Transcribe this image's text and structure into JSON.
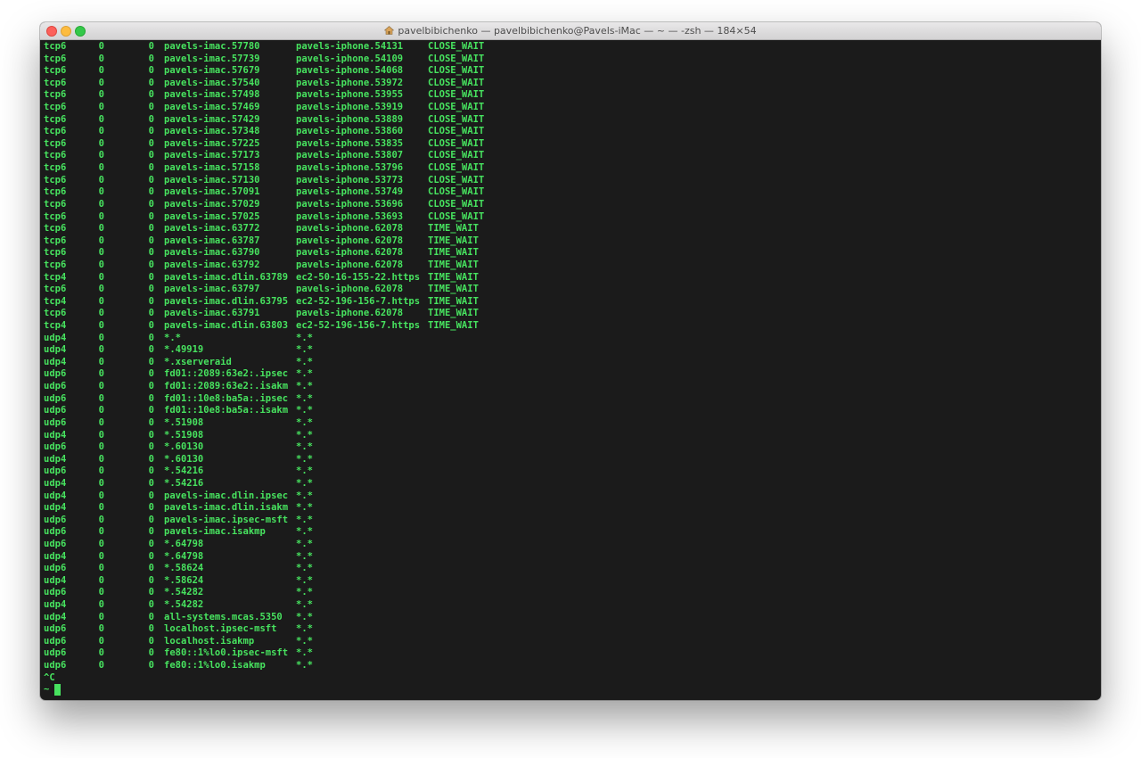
{
  "window": {
    "title": "pavelbibichenko — pavelbibichenko@Pavels-iMac — ~ — -zsh — 184×54",
    "title_icon": "home-icon"
  },
  "terminal": {
    "text_color": "#47e35f",
    "background_color": "#1b1b1b",
    "rows": [
      [
        "tcp6",
        "0",
        "0",
        "pavels-imac.57780",
        "pavels-iphone.54131",
        "CLOSE_WAIT"
      ],
      [
        "tcp6",
        "0",
        "0",
        "pavels-imac.57739",
        "pavels-iphone.54109",
        "CLOSE_WAIT"
      ],
      [
        "tcp6",
        "0",
        "0",
        "pavels-imac.57679",
        "pavels-iphone.54068",
        "CLOSE_WAIT"
      ],
      [
        "tcp6",
        "0",
        "0",
        "pavels-imac.57540",
        "pavels-iphone.53972",
        "CLOSE_WAIT"
      ],
      [
        "tcp6",
        "0",
        "0",
        "pavels-imac.57498",
        "pavels-iphone.53955",
        "CLOSE_WAIT"
      ],
      [
        "tcp6",
        "0",
        "0",
        "pavels-imac.57469",
        "pavels-iphone.53919",
        "CLOSE_WAIT"
      ],
      [
        "tcp6",
        "0",
        "0",
        "pavels-imac.57429",
        "pavels-iphone.53889",
        "CLOSE_WAIT"
      ],
      [
        "tcp6",
        "0",
        "0",
        "pavels-imac.57348",
        "pavels-iphone.53860",
        "CLOSE_WAIT"
      ],
      [
        "tcp6",
        "0",
        "0",
        "pavels-imac.57225",
        "pavels-iphone.53835",
        "CLOSE_WAIT"
      ],
      [
        "tcp6",
        "0",
        "0",
        "pavels-imac.57173",
        "pavels-iphone.53807",
        "CLOSE_WAIT"
      ],
      [
        "tcp6",
        "0",
        "0",
        "pavels-imac.57158",
        "pavels-iphone.53796",
        "CLOSE_WAIT"
      ],
      [
        "tcp6",
        "0",
        "0",
        "pavels-imac.57130",
        "pavels-iphone.53773",
        "CLOSE_WAIT"
      ],
      [
        "tcp6",
        "0",
        "0",
        "pavels-imac.57091",
        "pavels-iphone.53749",
        "CLOSE_WAIT"
      ],
      [
        "tcp6",
        "0",
        "0",
        "pavels-imac.57029",
        "pavels-iphone.53696",
        "CLOSE_WAIT"
      ],
      [
        "tcp6",
        "0",
        "0",
        "pavels-imac.57025",
        "pavels-iphone.53693",
        "CLOSE_WAIT"
      ],
      [
        "tcp6",
        "0",
        "0",
        "pavels-imac.63772",
        "pavels-iphone.62078",
        "TIME_WAIT"
      ],
      [
        "tcp6",
        "0",
        "0",
        "pavels-imac.63787",
        "pavels-iphone.62078",
        "TIME_WAIT"
      ],
      [
        "tcp6",
        "0",
        "0",
        "pavels-imac.63790",
        "pavels-iphone.62078",
        "TIME_WAIT"
      ],
      [
        "tcp6",
        "0",
        "0",
        "pavels-imac.63792",
        "pavels-iphone.62078",
        "TIME_WAIT"
      ],
      [
        "tcp4",
        "0",
        "0",
        "pavels-imac.dlin.63789",
        "ec2-50-16-155-22.https",
        "TIME_WAIT"
      ],
      [
        "tcp6",
        "0",
        "0",
        "pavels-imac.63797",
        "pavels-iphone.62078",
        "TIME_WAIT"
      ],
      [
        "tcp4",
        "0",
        "0",
        "pavels-imac.dlin.63795",
        "ec2-52-196-156-7.https",
        "TIME_WAIT"
      ],
      [
        "tcp6",
        "0",
        "0",
        "pavels-imac.63791",
        "pavels-iphone.62078",
        "TIME_WAIT"
      ],
      [
        "tcp4",
        "0",
        "0",
        "pavels-imac.dlin.63803",
        "ec2-52-196-156-7.https",
        "TIME_WAIT"
      ],
      [
        "udp4",
        "0",
        "0",
        "*.*",
        "*.*",
        ""
      ],
      [
        "udp4",
        "0",
        "0",
        "*.49919",
        "*.*",
        ""
      ],
      [
        "udp4",
        "0",
        "0",
        "*.xserveraid",
        "*.*",
        ""
      ],
      [
        "udp6",
        "0",
        "0",
        "fd01::2089:63e2:.ipsec",
        "*.*",
        ""
      ],
      [
        "udp6",
        "0",
        "0",
        "fd01::2089:63e2:.isakm",
        "*.*",
        ""
      ],
      [
        "udp6",
        "0",
        "0",
        "fd01::10e8:ba5a:.ipsec",
        "*.*",
        ""
      ],
      [
        "udp6",
        "0",
        "0",
        "fd01::10e8:ba5a:.isakm",
        "*.*",
        ""
      ],
      [
        "udp6",
        "0",
        "0",
        "*.51908",
        "*.*",
        ""
      ],
      [
        "udp4",
        "0",
        "0",
        "*.51908",
        "*.*",
        ""
      ],
      [
        "udp6",
        "0",
        "0",
        "*.60130",
        "*.*",
        ""
      ],
      [
        "udp4",
        "0",
        "0",
        "*.60130",
        "*.*",
        ""
      ],
      [
        "udp6",
        "0",
        "0",
        "*.54216",
        "*.*",
        ""
      ],
      [
        "udp4",
        "0",
        "0",
        "*.54216",
        "*.*",
        ""
      ],
      [
        "udp4",
        "0",
        "0",
        "pavels-imac.dlin.ipsec",
        "*.*",
        ""
      ],
      [
        "udp4",
        "0",
        "0",
        "pavels-imac.dlin.isakm",
        "*.*",
        ""
      ],
      [
        "udp6",
        "0",
        "0",
        "pavels-imac.ipsec-msft",
        "*.*",
        ""
      ],
      [
        "udp6",
        "0",
        "0",
        "pavels-imac.isakmp",
        "*.*",
        ""
      ],
      [
        "udp6",
        "0",
        "0",
        "*.64798",
        "*.*",
        ""
      ],
      [
        "udp4",
        "0",
        "0",
        "*.64798",
        "*.*",
        ""
      ],
      [
        "udp6",
        "0",
        "0",
        "*.58624",
        "*.*",
        ""
      ],
      [
        "udp4",
        "0",
        "0",
        "*.58624",
        "*.*",
        ""
      ],
      [
        "udp6",
        "0",
        "0",
        "*.54282",
        "*.*",
        ""
      ],
      [
        "udp4",
        "0",
        "0",
        "*.54282",
        "*.*",
        ""
      ],
      [
        "udp4",
        "0",
        "0",
        "all-systems.mcas.5350",
        "*.*",
        ""
      ],
      [
        "udp6",
        "0",
        "0",
        "localhost.ipsec-msft",
        "*.*",
        ""
      ],
      [
        "udp6",
        "0",
        "0",
        "localhost.isakmp",
        "*.*",
        ""
      ],
      [
        "udp6",
        "0",
        "0",
        "fe80::1%lo0.ipsec-msft",
        "*.*",
        ""
      ],
      [
        "udp6",
        "0",
        "0",
        "fe80::1%lo0.isakmp",
        "*.*",
        ""
      ]
    ],
    "interrupt_line": "^C",
    "prompt": "~"
  }
}
